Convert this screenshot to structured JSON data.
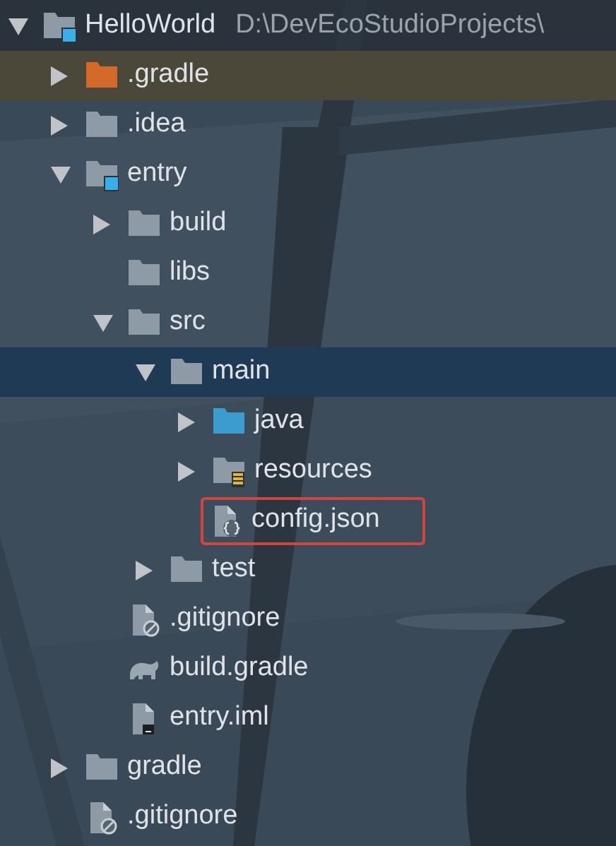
{
  "project_tree": [
    {
      "label": "HelloWorld",
      "path": "D:\\DevEcoStudioProjects\\",
      "kind": "module",
      "expanded": true,
      "selected": false,
      "children": [
        {
          "label": ".gradle",
          "kind": "excluded-folder",
          "expanded": false,
          "selected": false
        },
        {
          "label": ".idea",
          "kind": "folder",
          "expanded": false,
          "selected": false
        },
        {
          "label": "entry",
          "kind": "module",
          "expanded": true,
          "selected": false,
          "children": [
            {
              "label": "build",
              "kind": "folder",
              "expanded": false,
              "selected": false
            },
            {
              "label": "libs",
              "kind": "folder",
              "selected": false
            },
            {
              "label": "src",
              "kind": "folder",
              "expanded": true,
              "selected": false,
              "children": [
                {
                  "label": "main",
                  "kind": "folder",
                  "expanded": true,
                  "selected": true,
                  "children": [
                    {
                      "label": "java",
                      "kind": "source-folder",
                      "expanded": false,
                      "selected": false
                    },
                    {
                      "label": "resources",
                      "kind": "resources-folder",
                      "expanded": false,
                      "selected": false
                    },
                    {
                      "label": "config.json",
                      "kind": "json-file",
                      "selected": false,
                      "marked": true
                    }
                  ]
                },
                {
                  "label": "test",
                  "kind": "folder",
                  "expanded": false,
                  "selected": false
                }
              ]
            },
            {
              "label": ".gitignore",
              "kind": "ignore-file",
              "selected": false
            },
            {
              "label": "build.gradle",
              "kind": "gradle-file",
              "selected": false
            },
            {
              "label": "entry.iml",
              "kind": "iml-file",
              "selected": false
            }
          ]
        },
        {
          "label": "gradle",
          "kind": "folder",
          "expanded": false,
          "selected": false
        },
        {
          "label": ".gitignore",
          "kind": "ignore-file",
          "selected": false
        }
      ]
    }
  ]
}
